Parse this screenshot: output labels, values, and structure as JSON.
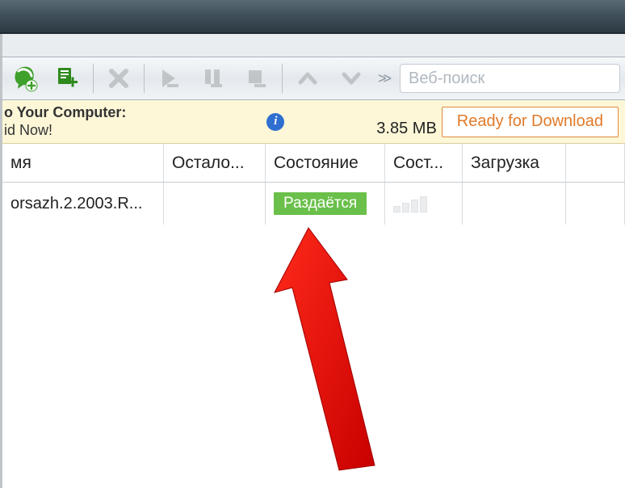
{
  "search": {
    "placeholder": "Веб-поиск"
  },
  "banner": {
    "line1": "o Your Computer:",
    "line2": "id Now!",
    "size": "3.85 MB",
    "button": "Ready for Download"
  },
  "columns": {
    "name": "мя",
    "remaining": "Остало...",
    "status": "Состояние",
    "health": "Сост...",
    "download": "Загрузка",
    "last": ""
  },
  "rows": [
    {
      "name": "orsazh.2.2003.R...",
      "remaining": "",
      "status": "Раздаётся",
      "download": ""
    }
  ],
  "more": ">>"
}
